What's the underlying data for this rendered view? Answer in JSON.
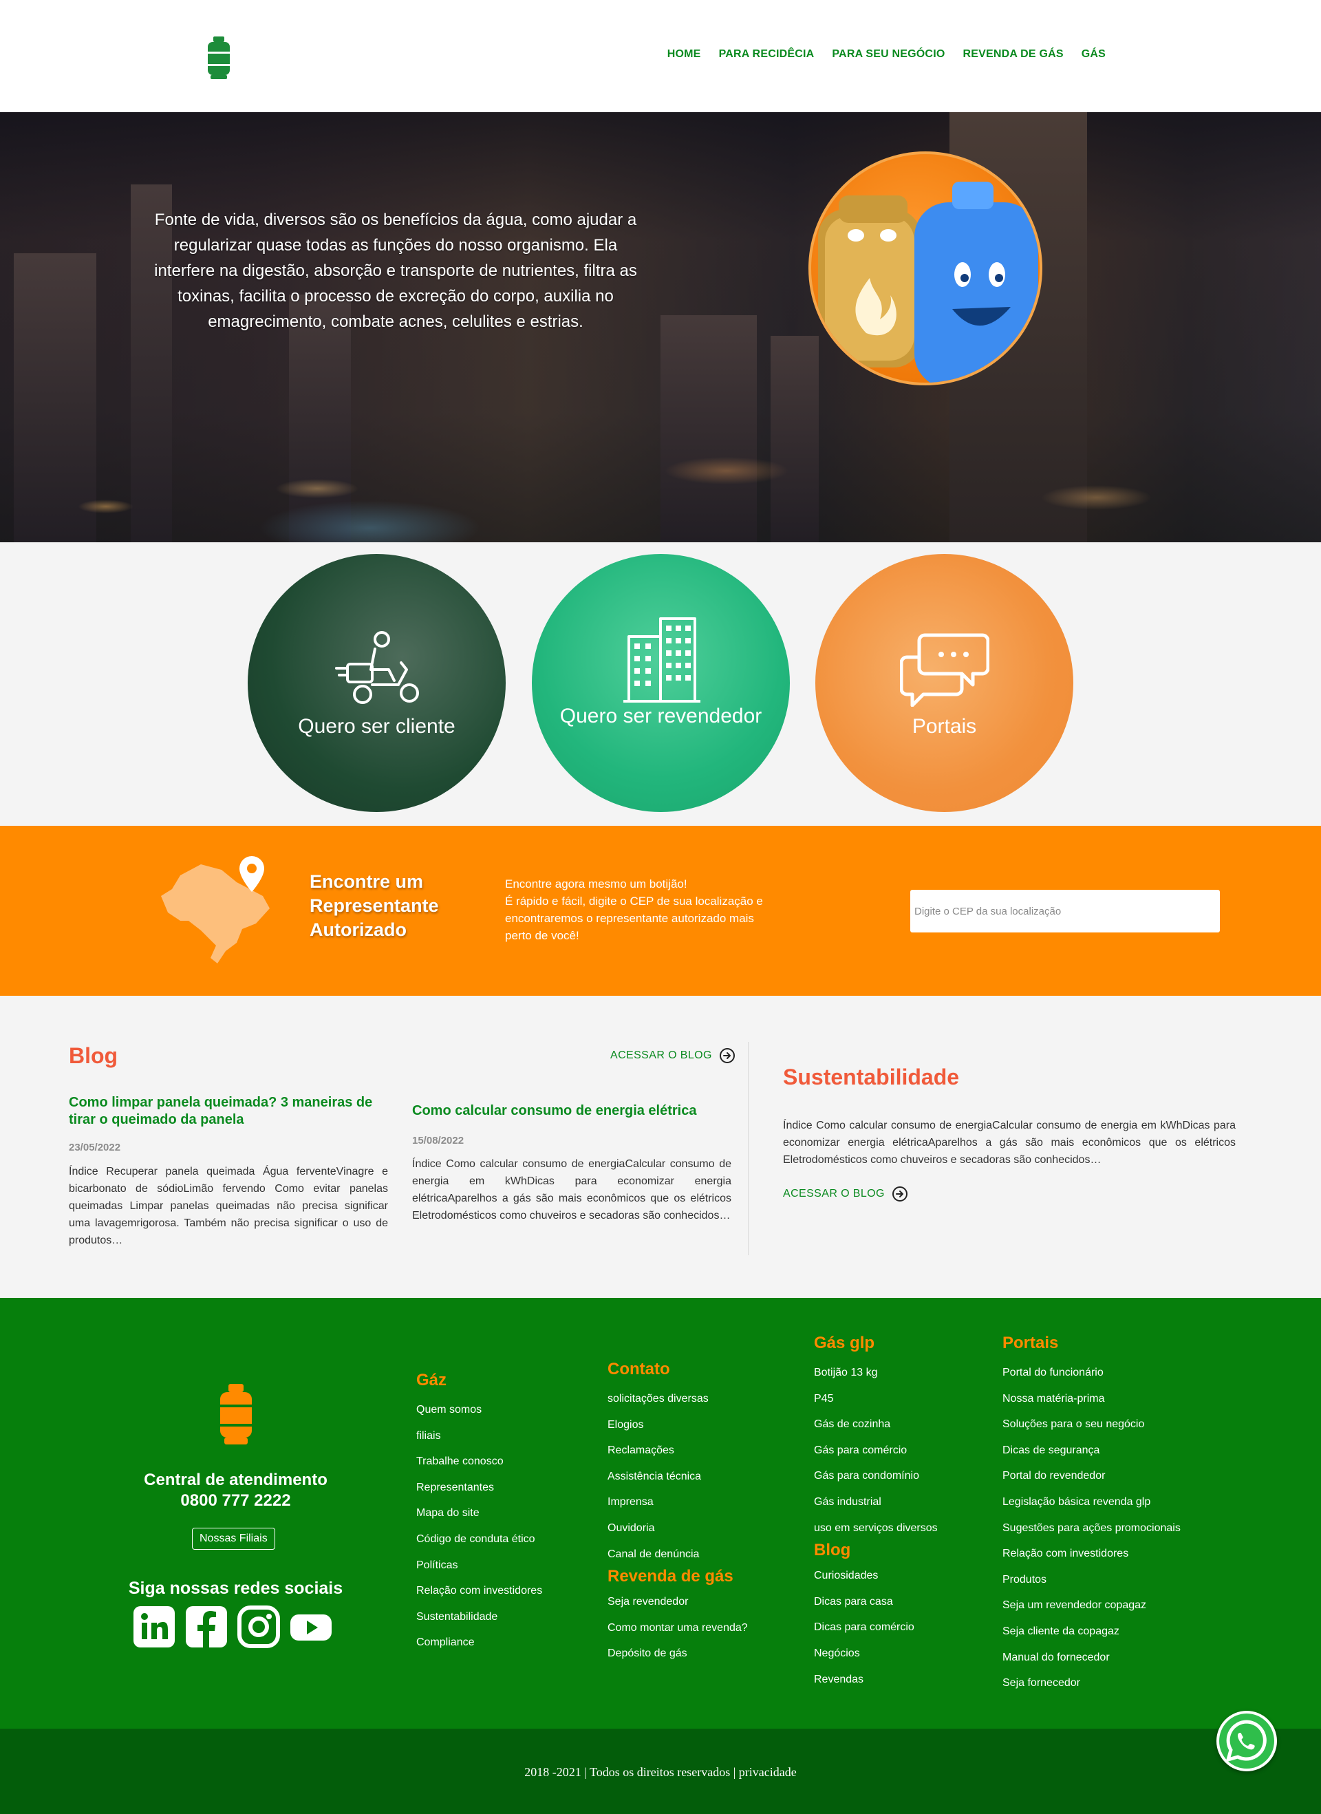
{
  "nav": {
    "items": [
      {
        "label": "HOME"
      },
      {
        "label": "PARA RECIDÊCIA"
      },
      {
        "label": "PARA SEU NEGÓCIO"
      },
      {
        "label": "REVENDA DE GÁS"
      },
      {
        "label": "GÁS"
      }
    ]
  },
  "hero": {
    "text": "Fonte de vida, diversos são os benefícios da água, como ajudar a regularizar quase todas as funções do nosso organismo. Ela interfere na digestão, absorção e transporte de nutrientes, filtra as toxinas, facilita o processo de excreção do corpo, auxilia no emagrecimento, combate acnes, celulites e estrias."
  },
  "circles": [
    {
      "label": "Quero ser cliente",
      "icon": "delivery-scooter-icon"
    },
    {
      "label": "Quero ser revendedor",
      "icon": "building-icon"
    },
    {
      "label": "Portais",
      "icon": "chat-bubbles-icon"
    }
  ],
  "band": {
    "title": "Encontre um Representante Autorizado",
    "description_line1": "Encontre agora mesmo um botijão!",
    "description_line2": "É rápido e fácil, digite o CEP de sua localização e encontraremos o representante autorizado mais perto de você!",
    "cep_placeholder": "Digite o CEP da sua localização",
    "icon": "brazil-map-pin-icon"
  },
  "blog": {
    "title": "Blog",
    "link_label": "ACESSAR O BLOG",
    "posts": [
      {
        "title": "Como limpar panela queimada? 3 maneiras de tirar o queimado da panela",
        "date": "23/05/2022",
        "excerpt": "Índice Recuperar panela queimada Água ferventeVinagre e bicarbonato de sódioLimão fervendo Como evitar panelas queimadas Limpar panelas queimadas não precisa significar uma lavagemrigorosa. Também não precisa significar o uso de produtos…"
      },
      {
        "title": "Como calcular consumo de energia elétrica",
        "date": "15/08/2022",
        "excerpt": "Índice Como calcular consumo de energiaCalcular consumo de energia em kWhDicas para economizar energia elétricaAparelhos a gás são mais econômicos que os elétricos Eletrodomésticos como chuveiros e secadoras são conhecidos…"
      }
    ]
  },
  "sustentabilidade": {
    "title": "Sustentabilidade",
    "text": "Índice Como calcular consumo de energiaCalcular consumo de energia em kWhDicas para economizar energia elétricaAparelhos a gás são mais econômicos que os elétricos Eletrodomésticos como chuveiros e secadoras são conhecidos…",
    "link_label": "ACESSAR O BLOG"
  },
  "footer": {
    "central_title": "Central de atendimento",
    "central_phone": "0800 777 2222",
    "filiais_button": "Nossas Filiais",
    "social_title": "Siga nossas redes sociais",
    "social_icons": [
      "linkedin-icon",
      "facebook-icon",
      "instagram-icon",
      "youtube-icon"
    ],
    "gaz": {
      "title": "Gáz",
      "links": [
        "Quem somos",
        "filiais",
        "Trabalhe conosco",
        "Representantes",
        "Mapa do site",
        "Código de conduta ético",
        "Políticas",
        "Relação com investidores",
        "Sustentabilidade",
        "Compliance"
      ]
    },
    "contato": {
      "title": "Contato",
      "links": [
        "solicitações diversas",
        "Elogios",
        "Reclamações",
        "Assistência técnica",
        "Imprensa",
        "Ouvidoria",
        "Canal de denúncia"
      ]
    },
    "revenda": {
      "title": "Revenda de gás",
      "links": [
        "Seja revendedor",
        "Como montar uma revenda?",
        "Depósito de gás"
      ]
    },
    "gasglp": {
      "title": "Gás glp",
      "links": [
        "Botijão 13 kg",
        "P45",
        "Gás de cozinha",
        "Gás para comércio",
        "Gás para condomínio",
        "Gás industrial",
        "uso em serviços diversos"
      ]
    },
    "blog": {
      "title": "Blog",
      "links": [
        "Curiosidades",
        "Dicas para casa",
        "Dicas para comércio",
        "Negócios",
        "Revendas"
      ]
    },
    "portais": {
      "title": "Portais",
      "links": [
        "Portal do funcionário",
        "Nossa matéria-prima",
        "Soluções para o seu negócio",
        "Dicas de segurança",
        "Portal do revendedor",
        "Legislação básica revenda glp",
        "Sugestões para ações promocionais",
        "Relação com investidores",
        "Produtos",
        "Seja um revendedor copagaz",
        "Seja cliente da copagaz",
        "Manual do fornecedor",
        "Seja fornecedor"
      ]
    },
    "copyright": "2018 -2021 | Todos os direitos reservados | privacidade"
  },
  "colors": {
    "green": "#0a8a1f",
    "footer_green": "#067f0c",
    "orange": "#ff8a00",
    "blog_title": "#f05a3a"
  }
}
